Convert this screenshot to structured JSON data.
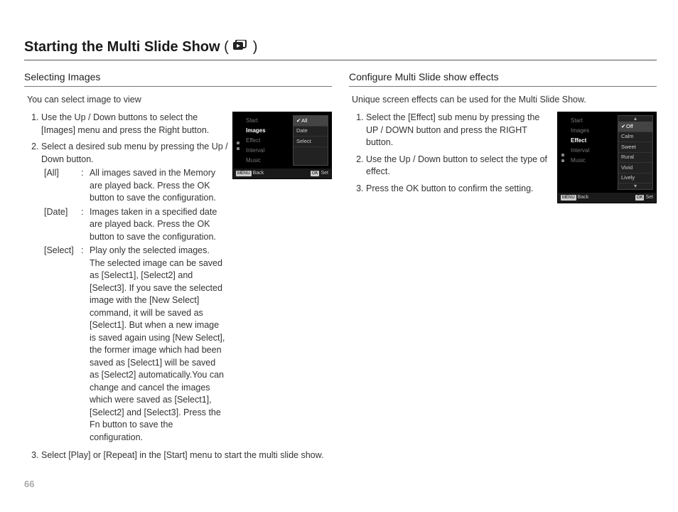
{
  "pageNumber": "66",
  "title_pre": "Starting the Multi Slide Show",
  "title_open": "(",
  "title_close": ")",
  "left": {
    "heading": "Selecting Images",
    "intro": "You can select image to view",
    "step1": "Use the Up / Down buttons to select the [Images] menu and press the Right button.",
    "step2": "Select a desired sub menu by pressing the Up / Down button.",
    "def": {
      "all_k": "[All]",
      "all_v": "All images saved in the Memory are played back. Press the OK button to save the configuration.",
      "date_k": "[Date]",
      "date_v": "Images taken in a specified date are played back. Press the OK button to save the configuration.",
      "select_k": "[Select]",
      "select_v": "Play only the selected images. The selected image can be saved as [Select1], [Select2] and [Select3]. If you save the selected image with the [New Select] command, it will be saved as [Select1]. But when a new image is saved again using [New Select], the former image which had been saved as [Select1] will be saved as [Select2] automatically.You can change and cancel the images which were saved as [Select1], [Select2] and [Select3]. Press the Fn button to save the configuration."
    },
    "step3": "Select [Play] or [Repeat] in the [Start] menu to start the multi slide show.",
    "menu": {
      "items": [
        "Start",
        "Images",
        "Effect",
        "Interval",
        "Music"
      ],
      "selectedIndex": 1,
      "sub": [
        "All",
        "Date",
        "Select"
      ],
      "subSelectedIndex": 0,
      "footLeftBadge": "MENU",
      "footLeft": "Back",
      "footRightBadge": "OK",
      "footRight": "Set"
    }
  },
  "right": {
    "heading": "Configure Multi Slide show effects",
    "intro": "Unique screen effects can be used for the Multi Slide Show.",
    "step1": "Select the [Effect] sub menu by pressing the UP / DOWN button and press the RIGHT button.",
    "step2": "Use the Up / Down button to select the type of effect.",
    "step3": "Press the OK button to confirm the setting.",
    "menu": {
      "items": [
        "Start",
        "Images",
        "Effect",
        "Interval",
        "Music"
      ],
      "selectedIndex": 2,
      "sub": [
        "Off",
        "Calm",
        "Sweet",
        "Rural",
        "Vivid",
        "Lively"
      ],
      "subSelectedIndex": 0,
      "footLeftBadge": "MENU",
      "footLeft": "Back",
      "footRightBadge": "OK",
      "footRight": "Set"
    }
  }
}
